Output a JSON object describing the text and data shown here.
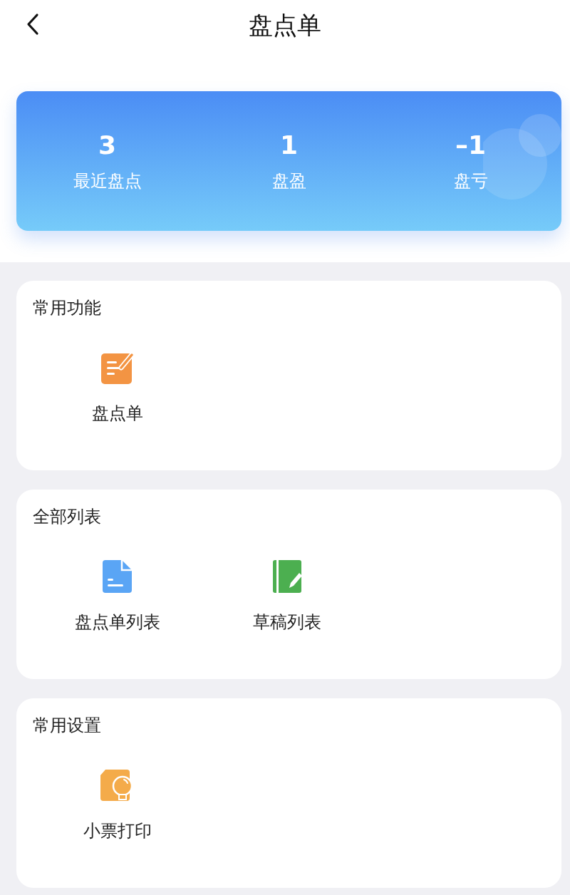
{
  "header": {
    "title": "盘点单"
  },
  "stats": [
    {
      "value": "3",
      "label": "最近盘点"
    },
    {
      "value": "1",
      "label": "盘盈"
    },
    {
      "value": "–1",
      "label": "盘亏"
    }
  ],
  "sections": [
    {
      "title": "常用功能",
      "items": [
        {
          "label": "盘点单",
          "kind": "form"
        }
      ]
    },
    {
      "title": "全部列表",
      "items": [
        {
          "label": "盘点单列表",
          "kind": "document"
        },
        {
          "label": "草稿列表",
          "kind": "notebook"
        }
      ]
    },
    {
      "title": "常用设置",
      "items": [
        {
          "label": "小票打印",
          "kind": "bulb"
        }
      ]
    }
  ]
}
